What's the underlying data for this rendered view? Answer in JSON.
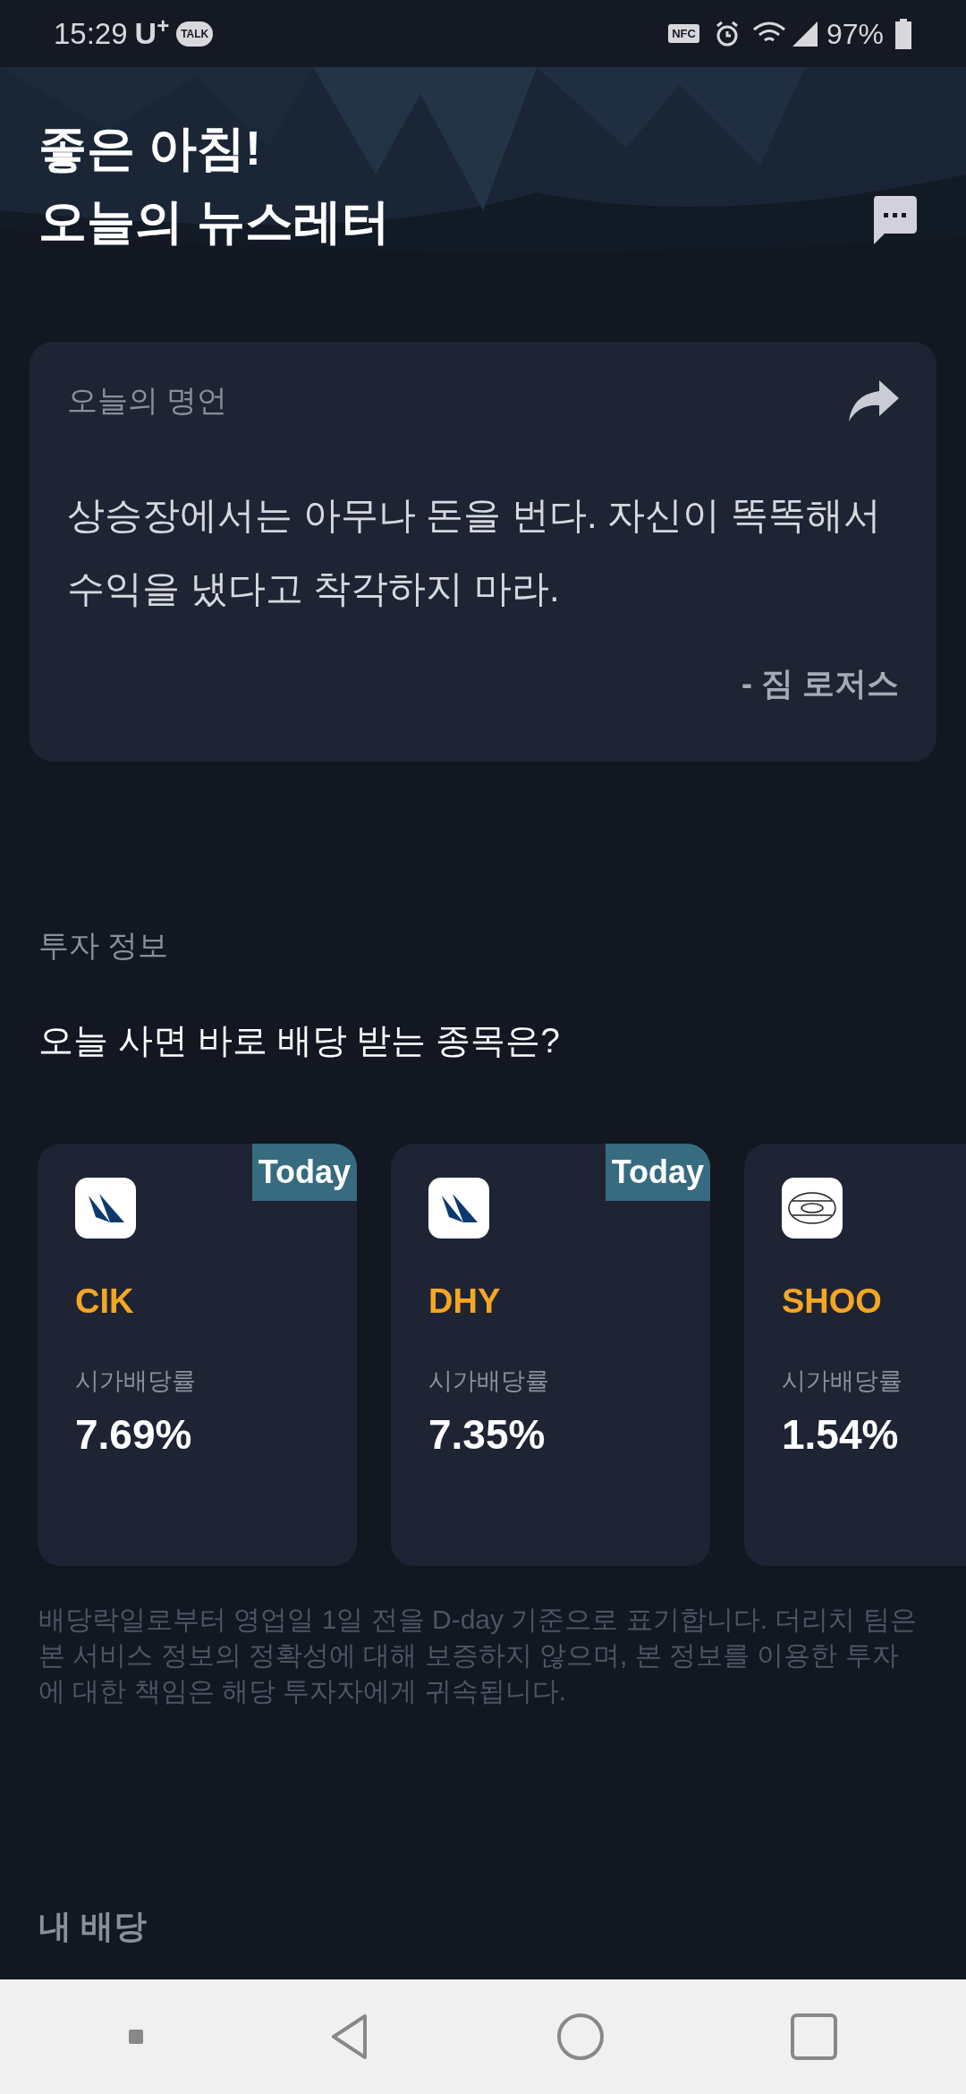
{
  "status_bar": {
    "time": "15:29",
    "carrier": "U",
    "carrier_mark": "+",
    "talk_badge": "TALK",
    "nfc": "NFC",
    "battery": "97%"
  },
  "header": {
    "greeting": "좋은 아침!",
    "title": "오늘의 뉴스레터"
  },
  "quote_card": {
    "label": "오늘의 명언",
    "quote": "상승장에서는 아무나 돈을 번다. 자신이 똑똑해서 수익을 냈다고 착각하지 마라.",
    "author": "- 짐 로저스"
  },
  "investment": {
    "section_label": "투자 정보",
    "heading": "오늘 사면 바로 배당 받는 종목은?",
    "cards": [
      {
        "kind": "sail",
        "ticker": "CIK",
        "metric_label": "시가배당률",
        "value": "7.69%",
        "today": true,
        "badge": "Today"
      },
      {
        "kind": "sail",
        "ticker": "DHY",
        "metric_label": "시가배당률",
        "value": "7.35%",
        "today": true,
        "badge": "Today"
      },
      {
        "kind": "oval",
        "ticker": "SHOO",
        "metric_label": "시가배당률",
        "value": "1.54%"
      }
    ],
    "disclaimer": "배당락일로부터 영업일 1일 전을 D-day 기준으로 표기합니다. 더리치 팀은 본 서비스 정보의 정확성에 대해 보증하지 않으며, 본 정보를 이용한 투자에 대한 책임은 해당 투자자에게 귀속됩니다."
  },
  "my_dividends": {
    "label": "내 배당"
  }
}
